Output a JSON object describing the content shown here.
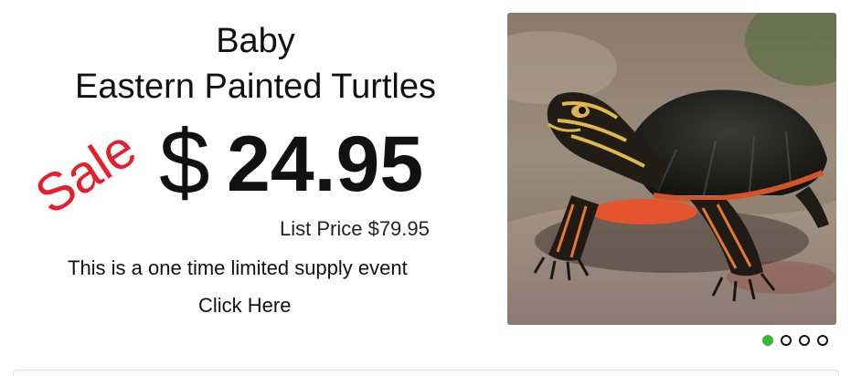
{
  "promo": {
    "title_line1": "Baby",
    "title_line2": "Eastern Painted Turtles",
    "sale_word": "Sale",
    "currency_symbol": "$",
    "sale_price": "24.95",
    "list_price": "List Price $79.95",
    "limited_note": "This is a one time limited supply event",
    "cta_label": "Click Here"
  },
  "carousel": {
    "slide_count": 4,
    "active_index": 0
  },
  "colors": {
    "sale_red": "#e5202e",
    "active_dot_green": "#3bb53b"
  }
}
